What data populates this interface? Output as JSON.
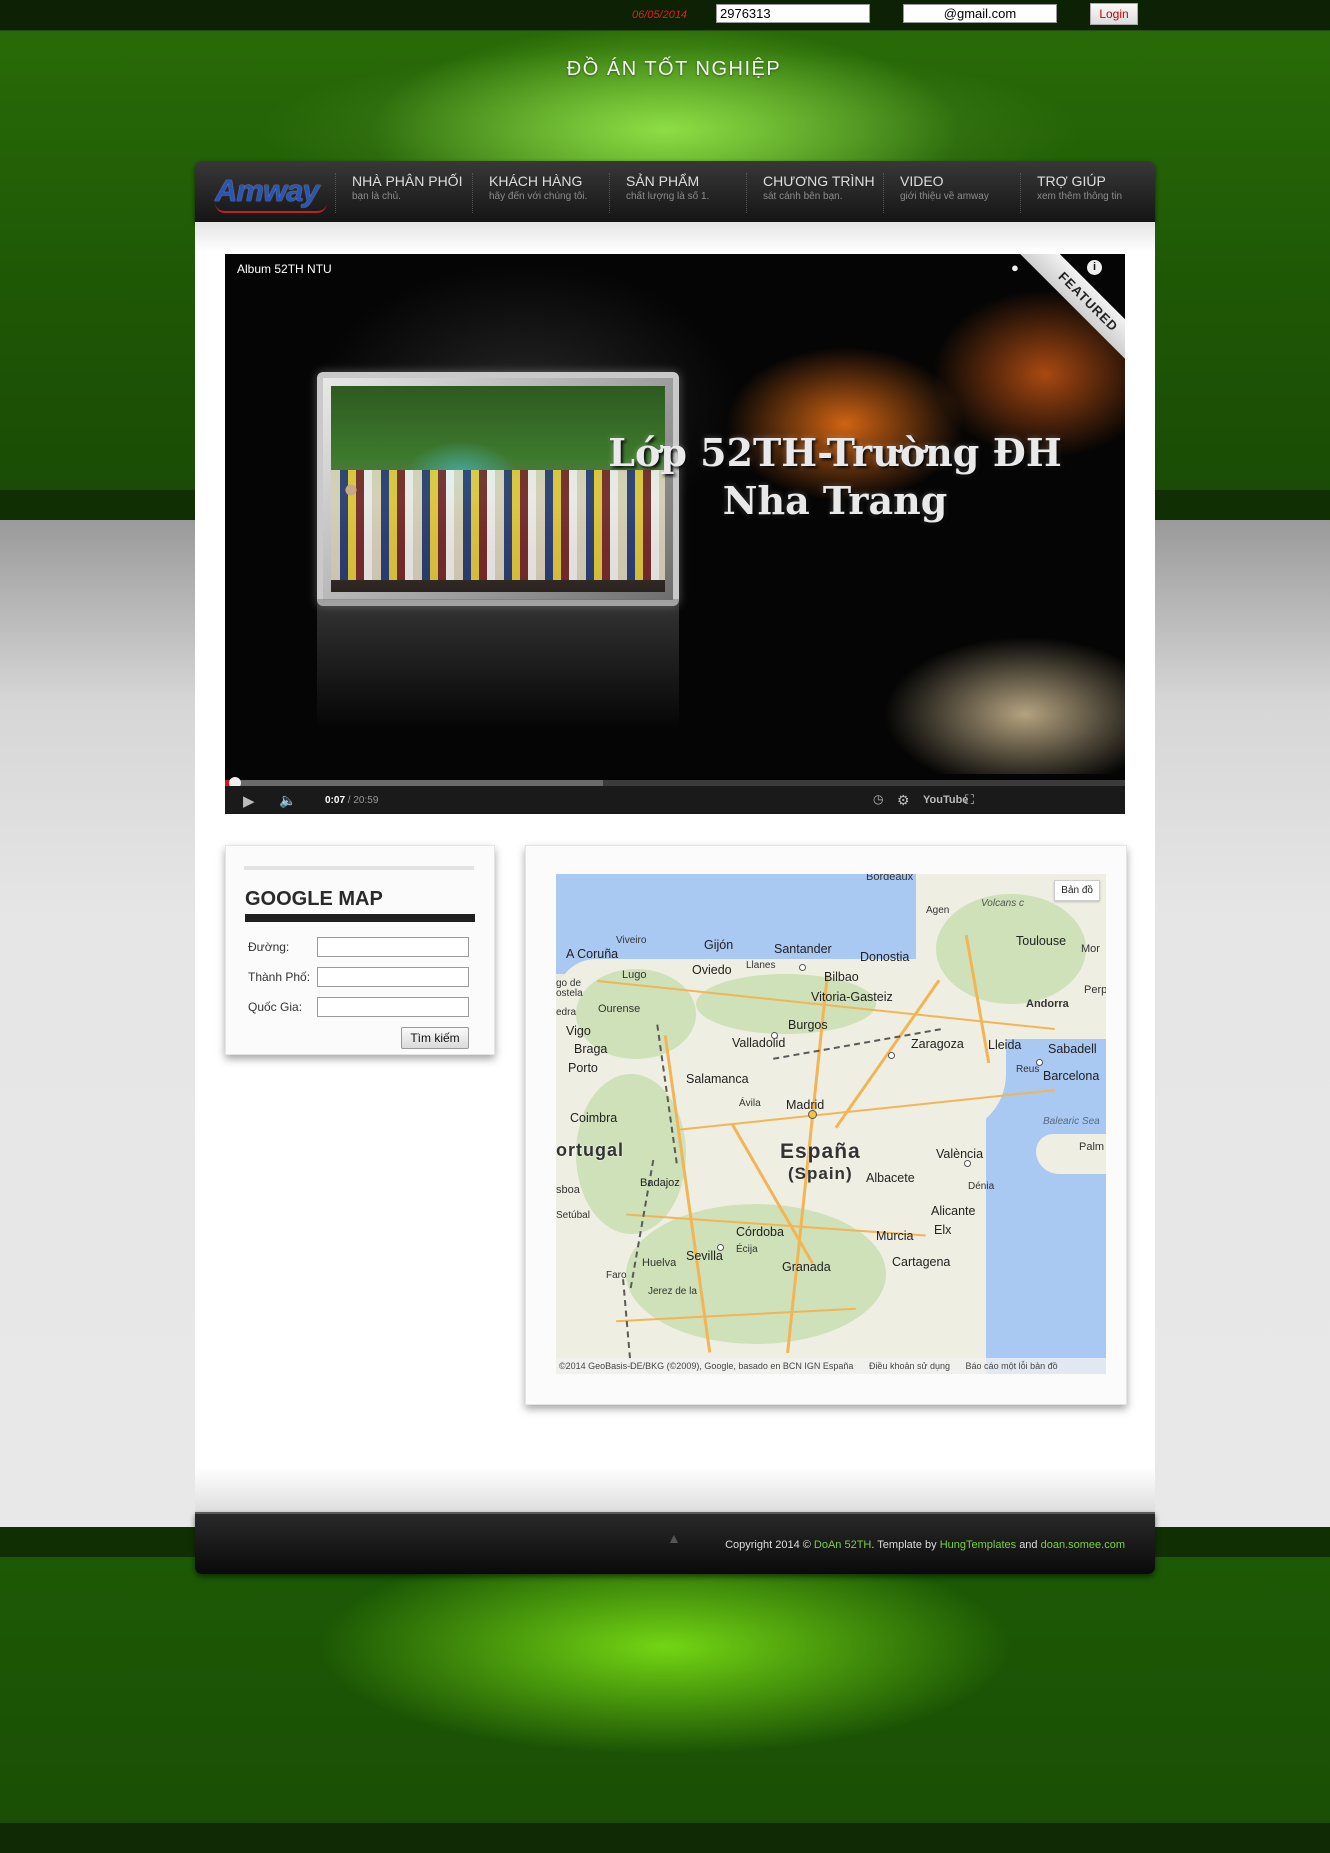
{
  "topbar": {
    "date": "06/05/2014",
    "user_value": "2976313",
    "email_value": "@gmail.com",
    "login_label": "Login"
  },
  "site_title": "ĐỒ ÁN TỐT NGHIỆP",
  "logo": {
    "text": "Amway",
    "brand_color": "#2a55b5"
  },
  "nav": [
    {
      "title": "NHÀ PHÂN PHỐI",
      "sub": "bạn là chủ."
    },
    {
      "title": "KHÁCH HÀNG",
      "sub": "hãy đến với chúng tôi."
    },
    {
      "title": "SẢN PHẨM",
      "sub": "chất lượng là số 1."
    },
    {
      "title": "CHƯƠNG TRÌNH",
      "sub": "sát cánh bên bạn."
    },
    {
      "title": "VIDEO",
      "sub": "giới thiệu về amway"
    },
    {
      "title": "TRỢ GIÚP",
      "sub": "xem thêm thông tin"
    }
  ],
  "video": {
    "title": "Album 52TH NTU",
    "overlay_line1": "Lớp 52TH-Trường ĐH",
    "overlay_line2": "Nha Trang",
    "ribbon": "FEATURED",
    "time_current": "0:07",
    "time_total": "20:59",
    "progress": 0.0056,
    "buffered": 0.42,
    "icons": [
      "watch-later-icon",
      "share-icon",
      "info-icon",
      "play-icon",
      "volume-icon",
      "clock-icon",
      "settings-icon",
      "youtube-icon",
      "fullscreen-icon"
    ],
    "youtube_label": "YouTube"
  },
  "google_map_form": {
    "title": "GOOGLE MAP",
    "street_label": "Đường:",
    "city_label": "Thành Phố:",
    "country_label": "Quốc Gia:",
    "street_value": "",
    "city_value": "",
    "country_value": "",
    "search_label": "Tìm kiếm"
  },
  "map": {
    "type_button": "Bản đồ",
    "country": "España",
    "country_sub": "(Spain)",
    "portugal": "ortugal",
    "sea_balearic": "Balearic Sea",
    "attrib": "©2014 GeoBasis-DE/BKG (©2009), Google, basado en BCN IGN España",
    "terms": "Điều khoản sử dụng",
    "report": "Báo cáo một lỗi bản đồ",
    "cities": {
      "bordeaux": "Bordeaux",
      "agen": "Agen",
      "volcans": "Volcans c",
      "toulouse": "Toulouse",
      "mor": "Mor",
      "perp": "Perp",
      "andorra": "Andorra",
      "viveiro": "Viveiro",
      "gijon": "Gijón",
      "santander": "Santander",
      "donostia": "Donostia",
      "coruna": "A Coruña",
      "oviedo": "Oviedo",
      "llanes": "Llanes",
      "bilbao": "Bilbao",
      "lugo": "Lugo",
      "godeo": "go de",
      "ostela": "ostela",
      "vitoria": "Vitoria-Gasteiz",
      "edra": "edra",
      "ourense": "Ourense",
      "vigo": "Vigo",
      "burgos": "Burgos",
      "braga": "Braga",
      "valladolid": "Valladolid",
      "zaragoza": "Zaragoza",
      "lleida": "Lleida",
      "sabadell": "Sabadell",
      "porto": "Porto",
      "salamanca": "Salamanca",
      "reus": "Reus",
      "barcelona": "Barcelona",
      "avila": "Ávila",
      "madrid": "Madrid",
      "coimbra": "Coimbra",
      "valencia": "València",
      "palm": "Palm",
      "sboa": "sboa",
      "badajoz": "Badajoz",
      "albacete": "Albacete",
      "denia": "Dénia",
      "setubal": "Setúbal",
      "alicante": "Alicante",
      "elx": "Elx",
      "cordoba": "Córdoba",
      "murcia": "Murcia",
      "ecija": "Écija",
      "huelva": "Huelva",
      "sevilla": "Sevilla",
      "granada": "Granada",
      "cartagena": "Cartagena",
      "faro": "Faro",
      "jerez": "Jerez de la"
    }
  },
  "footer": {
    "copyright": "Copyright 2014 ©",
    "site_name": "DoAn 52TH",
    "template_by": ". Template by",
    "author": "HungTemplates",
    "and": "and",
    "domain": "doan.somee.com",
    "accent_color": "#7ad23a"
  }
}
